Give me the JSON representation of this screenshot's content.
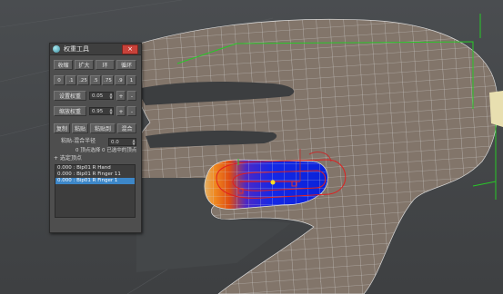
{
  "panel": {
    "title": "权重工具",
    "close_label": "×",
    "buttons_row1": [
      "收缩",
      "扩大",
      "环",
      "循环"
    ],
    "weight_presets": [
      "0",
      ".1",
      ".25",
      ".5",
      ".75",
      ".9",
      "1"
    ],
    "set_weight_label": "设置权重",
    "set_weight_value": "0.05",
    "scale_weight_label": "缩放权重",
    "scale_weight_value": "0.95",
    "plus_minus": [
      "+",
      "-"
    ],
    "buttons_row4": [
      "复制",
      "粘贴",
      "粘贴到",
      "混合"
    ],
    "blend_label": "粘贴-混合半径",
    "blend_value": "0.0",
    "vertex_info": "0 顶点选择 0 已选中的顶点",
    "section_label": "+ 选定顶点",
    "list_items": [
      {
        "text": "0.000 : Bip01 R Hand",
        "selected": false
      },
      {
        "text": "0.000 : Bip01 R Finger 11",
        "selected": false
      },
      {
        "text": "0.000 : Bip01 R Finger 1",
        "selected": true
      }
    ]
  }
}
